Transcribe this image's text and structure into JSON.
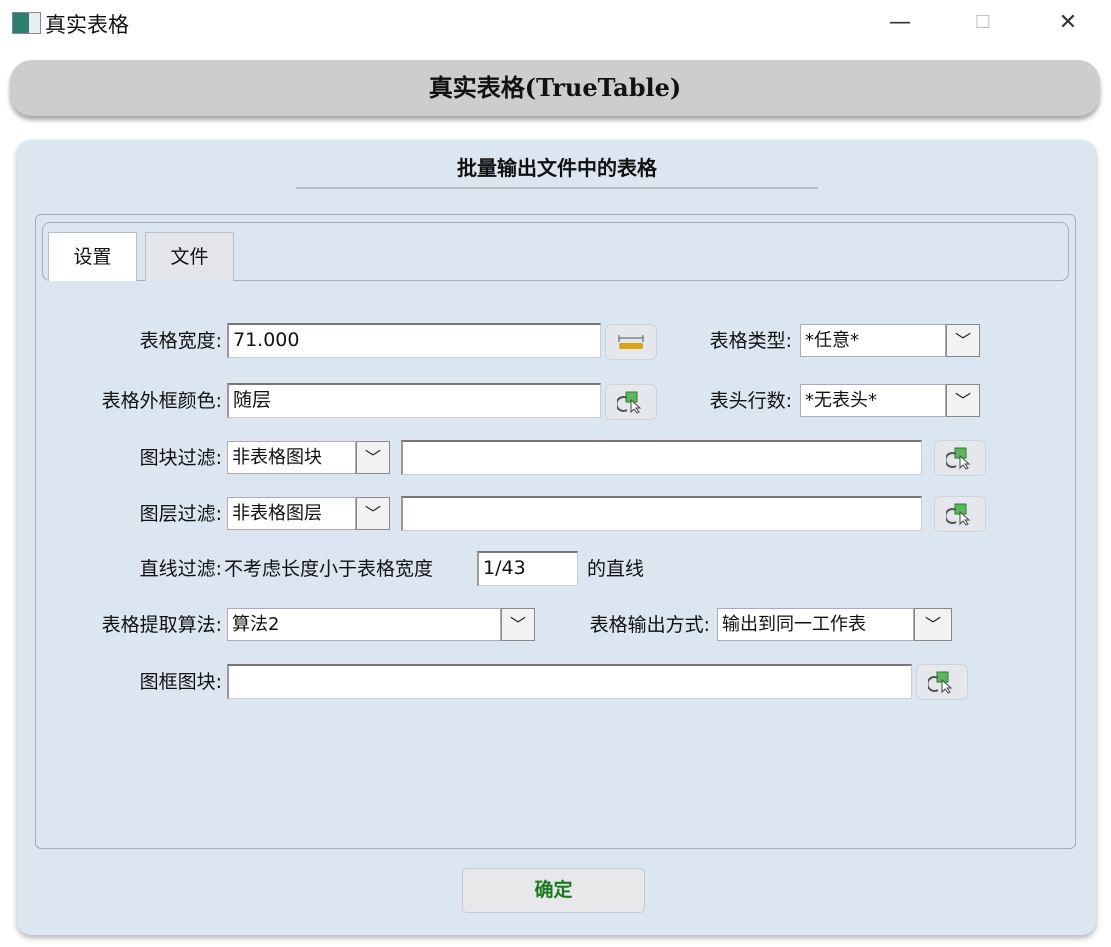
{
  "window": {
    "title": "真实表格",
    "minimize": "—",
    "maximize": "☐",
    "close": "✕"
  },
  "header": {
    "title": "真实表格(TrueTable)"
  },
  "panel": {
    "subtitle": "批量输出文件中的表格"
  },
  "tabs": [
    {
      "label": "设置",
      "active": true
    },
    {
      "label": "文件",
      "active": false
    }
  ],
  "form": {
    "table_width": {
      "label": "表格宽度:",
      "value": "71.000"
    },
    "table_type": {
      "label": "表格类型:",
      "value": "*任意*"
    },
    "border_color": {
      "label": "表格外框颜色:",
      "value": "随层"
    },
    "header_rows": {
      "label": "表头行数:",
      "value": "*无表头*"
    },
    "block_filter": {
      "label": "图块过滤:",
      "mode": "非表格图块",
      "value": ""
    },
    "layer_filter": {
      "label": "图层过滤:",
      "mode": "非表格图层",
      "value": ""
    },
    "line_filter": {
      "label": "直线过滤:",
      "prefix": "不考虑长度小于表格宽度",
      "value": "1/43",
      "suffix": "的直线"
    },
    "algorithm": {
      "label": "表格提取算法:",
      "value": "算法2"
    },
    "output_mode": {
      "label": "表格输出方式:",
      "value": "输出到同一工作表"
    },
    "frame_block": {
      "label": "图框图块:",
      "value": ""
    }
  },
  "confirm_label": "确定"
}
